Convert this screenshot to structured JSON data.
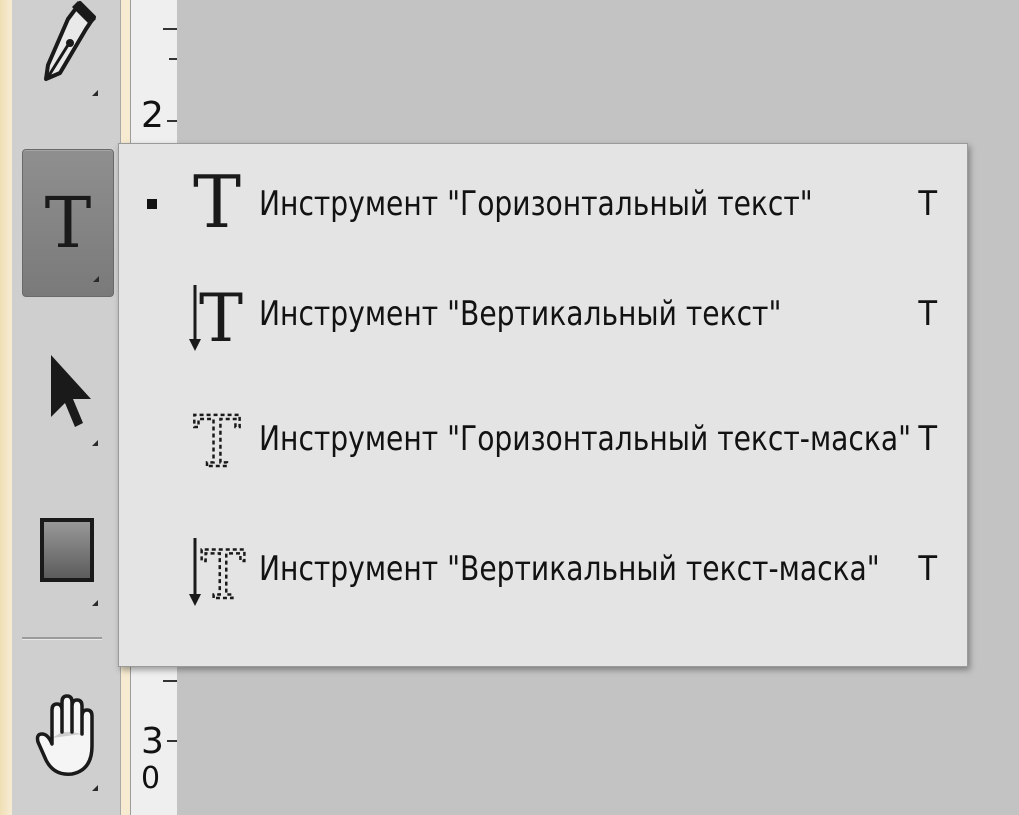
{
  "toolbar": {
    "tools": [
      {
        "name": "pen-tool",
        "icon": "pen-icon"
      },
      {
        "name": "type-tool",
        "icon": "type-icon",
        "glyph": "T",
        "active": true
      },
      {
        "name": "path-selection-tool",
        "icon": "arrow-icon"
      },
      {
        "name": "rectangle-tool",
        "icon": "rectangle-icon"
      },
      {
        "name": "hand-tool",
        "icon": "hand-icon"
      }
    ]
  },
  "ruler": {
    "top_label": "2",
    "bottom_label": "3",
    "bottom_label_2": "0"
  },
  "flyout_menu": {
    "items": [
      {
        "label": "Инструмент \"Горизонтальный текст\"",
        "shortcut": "T",
        "selected": true,
        "icon": "horizontal-type-icon"
      },
      {
        "label": "Инструмент \"Вертикальный текст\"",
        "shortcut": "T",
        "selected": false,
        "icon": "vertical-type-icon"
      },
      {
        "label": "Инструмент \"Горизонтальный текст-маска\"",
        "shortcut": "T",
        "selected": false,
        "icon": "horizontal-type-mask-icon"
      },
      {
        "label": "Инструмент \"Вертикальный текст-маска\"",
        "shortcut": "T",
        "selected": false,
        "icon": "vertical-type-mask-icon"
      }
    ]
  },
  "colors": {
    "frame": "#f6ead0",
    "toolbar": "#cfcfcf",
    "active_tool": "#828282",
    "canvas": "#c3c3c3",
    "menu": "#e4e4e4"
  }
}
